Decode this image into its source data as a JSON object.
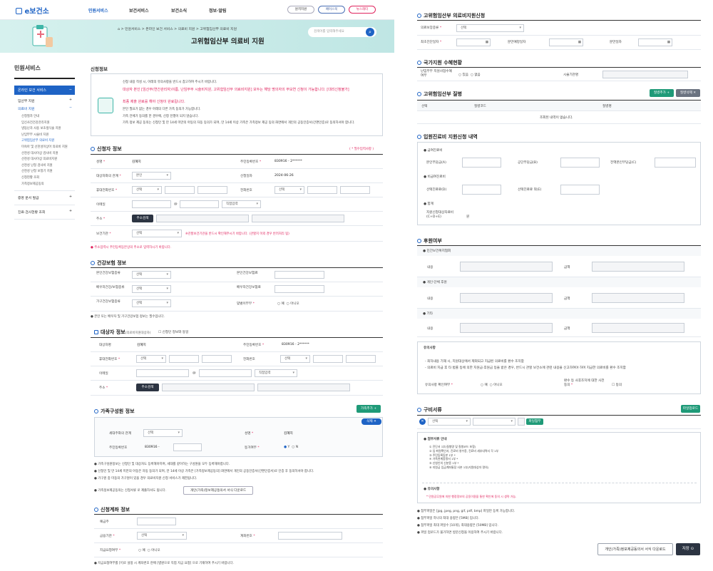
{
  "header": {
    "logo": "e보건소",
    "nav": [
      "민원서비스",
      "보건서비스",
      "보건소식",
      "정보·알림"
    ],
    "pills": [
      "원격지원",
      "페이스북",
      "뉴스레터"
    ]
  },
  "banner": {
    "crumbs": [
      "⌂",
      "민원서비스",
      "온라인 보건 서비스",
      "의료비 지원",
      "고위험임산부 의료비 지원"
    ],
    "title": "고위험임산부 의료비 지원",
    "search_ph": "검색어를 입력해주세요"
  },
  "sidebar": {
    "title": "민원서비스",
    "active": "온라인 보건 서비스",
    "items": [
      "임산부 지원",
      "의료비 지원"
    ],
    "sub": [
      "신청절차 안내",
      "임신사전건강관리지원",
      "냉동난자 사용 보조생식술 지원",
      "난임부부 시술비 지원",
      "고위험임산부 의료비 지원",
      "미숙아 및 선천성이상아 의료비 지원",
      "선천성 대사이상 검사비 지원",
      "선천성 대사이상 의료비지원",
      "선천성 난청 검사비 지원",
      "선천성 난청 보청기 지원",
      "신청현황 조회",
      "가족정보제공동의"
    ],
    "bottom": [
      "증명 문서 발급",
      "진료·검사현황 조회"
    ]
  },
  "info": {
    "title": "신청정보",
    "lines": [
      "신청 내용 작성 시, 아래의 유의사항을 반드시 참고하여 주시기 바랍니다.",
      "대상자 본인 [임산부(연간관리자)이름, 난임부부 시술비지원, 고위험임산부 의료비지원] 모두는 해당 명의자의 부모연 신청이 가능합니다. [대리신청불가]",
      "최종 제출 완료를 해야 신청이 완료됩니다.",
      "본인 필요가 없는 경우 아래의 다른 가족 동의가 가능합니다.",
      "가족 전체가 동의를 한 경우에, 신청 진행이 되지 않습니다.",
      "가족 정보 제공 동의는 신청인 및 만 14세 미만의 아동의 자동 동의가 되며, 만 14세 이상 가족은 가족정보 제공 동의 화면에서 개인의 공동인증서(간편인증)로 동의하셔야 합니다."
    ]
  },
  "applicant": {
    "title": "신청자 정보",
    "required_note": "( * 필수입력사항 )",
    "name_label": "성명",
    "name": "김혜지",
    "rrn_label": "주민등록번호",
    "rrn": "830916 - 2******",
    "rel_label": "대상자와의 관계",
    "rel_value": "본인",
    "date_label": "신청일자",
    "date": "2024-06-26",
    "mobile_label": "휴대전화번호",
    "phone_label": "전화번호",
    "email_label": "이메일",
    "at": "@",
    "email_sel": "직접입력",
    "addr_label": "주소",
    "addr_btn": "주소검색",
    "org_label": "보건기관",
    "org_note": "※관할보건기관을 반드시 확인해주시기 바랍니다. (관할지 이외 경우 반려처리 됨)",
    "foot": "주소입력시 주민등록등본상의 주소로 입력하시기 바랍니다.",
    "select": "선택"
  },
  "insurance": {
    "title": "건강보험 정보",
    "l1": "본인건강보험종류",
    "l2": "본인건강보험료",
    "l3": "배우자건강/보험종류",
    "l4": "배우자건강보험료",
    "l5": "가구건강보험종류",
    "l6": "맞벌이부부",
    "yes": "예",
    "no": "아니오",
    "foot": "본인 또는 배우자 및 가구건강보험 정보는 필수입니다."
  },
  "target": {
    "title": "대상자 정보",
    "sub": "(의료비지원대상자)",
    "same": "신청인 정보와 동일",
    "name": "김혜지",
    "rrn": "830916 - 2******",
    "labels": [
      "대상자명",
      "주민등록번호",
      "휴대전화번호",
      "전화번호",
      "이메일",
      "주소"
    ],
    "addr_btn": "주소검색"
  },
  "family": {
    "title": "가족구성원 정보",
    "add": "가족추가 +",
    "del": "삭제 ✕",
    "rel_label": "세대주와의 관계",
    "name_label": "성명",
    "name": "김혜지",
    "rrn_label": "주민등록번호",
    "rrn": "830916 -",
    "agree_label": "동거여부",
    "y": "Y",
    "n": "N",
    "notes": [
      "가족구성원정보는 신청인 및 대상자도 등록해야하며, 세대를 같이하는 구성원을 모두 등록해야합니다.",
      "신청인 및 만 14세 미만의 아동은 자동 동의가 되며, 만 14세 이상 가족은 [가족정보제공동의] 화면에서 개인의 공동인증서(간편인증서)로 인증 후 동의하셔야 합니다.",
      "가구원 중 미동의 가구원이 있을 경우 의료비지원 신청 서비스가 제한됩니다.",
      "가족정보제공동의는 신청서류 로 제출하셔도 됩니다."
    ],
    "form_btn": "개인(가족)정보제공동의서 서식 다운로드"
  },
  "account": {
    "title": "신청계좌 정보",
    "owner": "예금주",
    "bank": "금융기관",
    "acct": "계좌번호",
    "pay": "지급요청여부",
    "yes": "예",
    "no": "아니오",
    "foot": "지급요청여부를 [Y]로 설정 시 계좌번호 란에 [병원으로 직접 지급 요청] 으로 기재하여 주시기 바랍니다."
  },
  "medical": {
    "title": "고위험임산부 의료비지원신청",
    "l1": "의료보장종류",
    "l2": "최초진단일자",
    "l3": "분만예정일자",
    "l4": "분만일자"
  },
  "national": {
    "title": "국가지원 수혜현황",
    "l1": "난임부부 지원사업수혜여부",
    "yes": "있음",
    "no": "없음",
    "l2": "시술기관명"
  },
  "disease": {
    "title": "고위험임산부 질병",
    "add": "질병추가 +",
    "del": "질병삭제 ✕",
    "cols": [
      "선택",
      "질병코드",
      "질병명"
    ],
    "empty": "조회된 내역이 없습니다."
  },
  "inpatient": {
    "title": "입원진료비 지원신청 내역",
    "g1": "급여진료비",
    "a": "본인부담금(A)",
    "b": "공단부담금(B)",
    "c": "전액본인부담금(C)",
    "g2": "비급여진료비",
    "d": "선택진료료(D)",
    "e": "선택진료료 외(E)",
    "g3": "합계",
    "f": "지원신청대상자료비 (C+D+E)",
    "won": "원"
  },
  "support": {
    "title": "후원여부",
    "s1": "민간보건복지협회",
    "s2": "개인·단체 후원",
    "s3": "기타",
    "content": "내용",
    "amount": "금액"
  },
  "caution": {
    "title": "유의사항",
    "l1": "최하내용 기재 시, 지원대상에서 제외되고 지급된 의료비를 환수 조치함",
    "l2": "의료비 지급 후 타 법률 등에 의한 지원금·후원금 등을 받은 경우, 반드시 관할 보건소에 관련 내용을 신고하여야 하며 지급한 의료비를 환수 조치함",
    "confirm": "유의사항 확인여부",
    "y": "예",
    "n": "아니오",
    "l3": "환수 등 사후조치에 대한 사전동의",
    "agree": "동의"
  },
  "docs": {
    "title": "구비서류",
    "upload": "파일업로드",
    "attach": "파일첨부",
    "guide_title": "첨부서류 안내",
    "guide": [
      "① 진단서 1부(질병명 및 질병코드 포함)",
      "② 입·퇴원확인서, 진료비 영수증, 진료비 세부내역서 각 1부",
      "③ 주민등록등본 1부 *",
      "④ 가족관계증명서 1부 *",
      "⑤ 신청인의 신분증 1부 *",
      "⑥ 지원금 입금계좌통장 사본 1부(지원대상자 명의)"
    ],
    "caution_title": "유의사항",
    "caution": "* 민원공무원에 의한 행정정보의 공동이용을 통한 확인에 동의 시 생략 가능.",
    "notes": [
      "첨부파일은 [jpg, jpeg, png, gif, pdf, bmp] 파일만 등록 가능합니다.",
      "첨부파일 하나의 최대 용량은 [5MB] 입니다.",
      "첨부파일 최대 파일수 [10개], 최대용량은 [50MB] 입니다.",
      "파일 업로드가 불가하면 방문신청을 이용하여 주시기 바랍니다."
    ],
    "form_btn": "개인(가족)정보제공동의서 서식 다운로드",
    "save": "저장 ⊙"
  },
  "colors": {
    "accent": "#1e63c5",
    "green": "#1f9a78",
    "pink": "#e0245e"
  }
}
